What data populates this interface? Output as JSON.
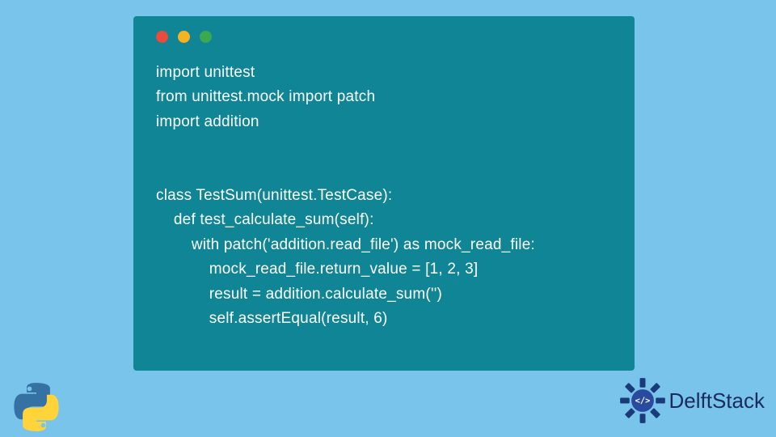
{
  "window": {
    "dots": {
      "red": "#e94b3c",
      "yellow": "#f5b221",
      "green": "#3ba94f"
    }
  },
  "code": {
    "line1": "import unittest",
    "line2": "from unittest.mock import patch",
    "line3": "import addition",
    "line4": "",
    "line5": "",
    "line6": "class TestSum(unittest.TestCase):",
    "line7": "    def test_calculate_sum(self):",
    "line8": "        with patch('addition.read_file') as mock_read_file:",
    "line9": "            mock_read_file.return_value = [1, 2, 3]",
    "line10": "            result = addition.calculate_sum('')",
    "line11": "            self.assertEqual(result, 6)"
  },
  "branding": {
    "name": "DelftStack"
  },
  "icons": {
    "python": "python-logo",
    "delftstack_badge": "delftstack-badge"
  }
}
